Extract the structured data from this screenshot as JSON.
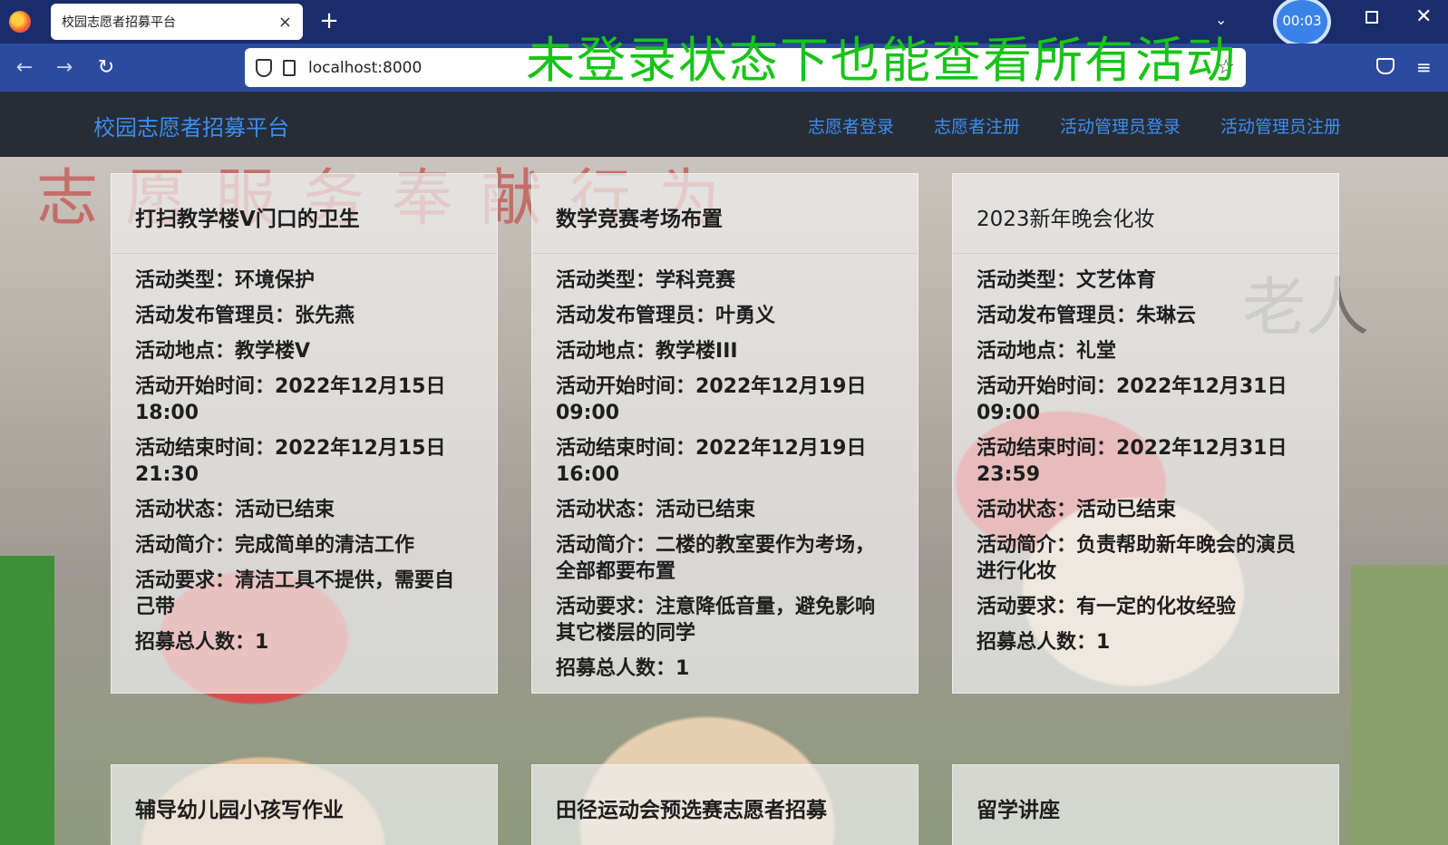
{
  "browser": {
    "tab_title": "校园志愿者招募平台",
    "tab_close": "×",
    "new_tab": "+",
    "tab_list": "⌄",
    "timer": "00:03",
    "url": "localhost:8000",
    "back": "←",
    "forward": "→",
    "reload": "↻",
    "star": "☆",
    "menu": "≡",
    "window_close": "✕"
  },
  "caption": "未登录状态下也能查看所有活动",
  "header": {
    "brand": "校园志愿者招募平台",
    "links": [
      "志愿者登录",
      "志愿者注册",
      "活动管理员登录",
      "活动管理员注册"
    ]
  },
  "background": {
    "sign_text": "志愿服务奉献行为",
    "side_text": "老人"
  },
  "labels": {
    "type": "活动类型：",
    "publisher": "活动发布管理员：",
    "location": "活动地点：",
    "start": "活动开始时间：",
    "end": "活动结束时间：",
    "status": "活动状态：",
    "intro": "活动简介：",
    "requirement": "活动要求：",
    "total": "招募总人数："
  },
  "activities": [
    {
      "title": "打扫教学楼V门口的卫生",
      "type": "环境保护",
      "publisher": "张先燕",
      "location": "教学楼V",
      "start": "2022年12月15日 18:00",
      "end": "2022年12月15日 21:30",
      "status": "活动已结束",
      "intro": "完成简单的清洁工作",
      "requirement": "清洁工具不提供，需要自己带",
      "total": "1"
    },
    {
      "title": "数学竞赛考场布置",
      "type": "学科竞赛",
      "publisher": "叶勇义",
      "location": "教学楼III",
      "start": "2022年12月19日 09:00",
      "end": "2022年12月19日 16:00",
      "status": "活动已结束",
      "intro": "二楼的教室要作为考场，全部都要布置",
      "requirement": "注意降低音量，避免影响其它楼层的同学",
      "total": "1"
    },
    {
      "title": "2023新年晚会化妆",
      "type": "文艺体育",
      "publisher": "朱琳云",
      "location": "礼堂",
      "start": "2022年12月31日 09:00",
      "end": "2022年12月31日 23:59",
      "status": "活动已结束",
      "intro": "负责帮助新年晚会的演员进行化妆",
      "requirement": "有一定的化妆经验",
      "total": "1"
    }
  ],
  "next_titles": [
    "辅导幼儿园小孩写作业",
    "田径运动会预选赛志愿者招募",
    "留学讲座"
  ]
}
